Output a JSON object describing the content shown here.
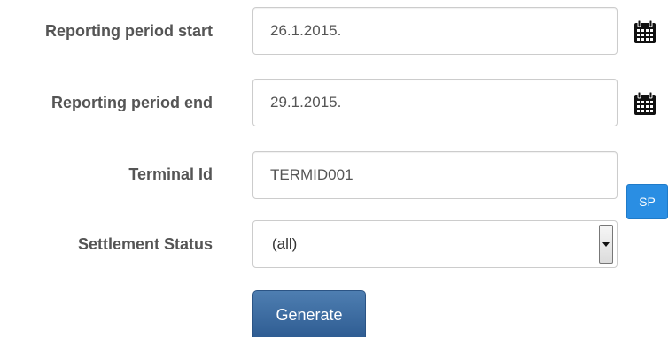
{
  "form": {
    "period_start": {
      "label": "Reporting period start",
      "value": "26.1.2015."
    },
    "period_end": {
      "label": "Reporting period end",
      "value": "29.1.2015."
    },
    "terminal": {
      "label": "Terminal Id",
      "value": "TERMID001",
      "button_label": "SP"
    },
    "settlement_status": {
      "label": "Settlement Status",
      "selected": "(all)"
    },
    "generate_label": "Generate"
  },
  "colors": {
    "label_text": "#555555",
    "sp_button": "#2a8ee3",
    "generate_button": "#3a6aa1"
  },
  "icons": {
    "date_picker": "calendar-icon",
    "dropdown": "chevron-down-icon"
  }
}
